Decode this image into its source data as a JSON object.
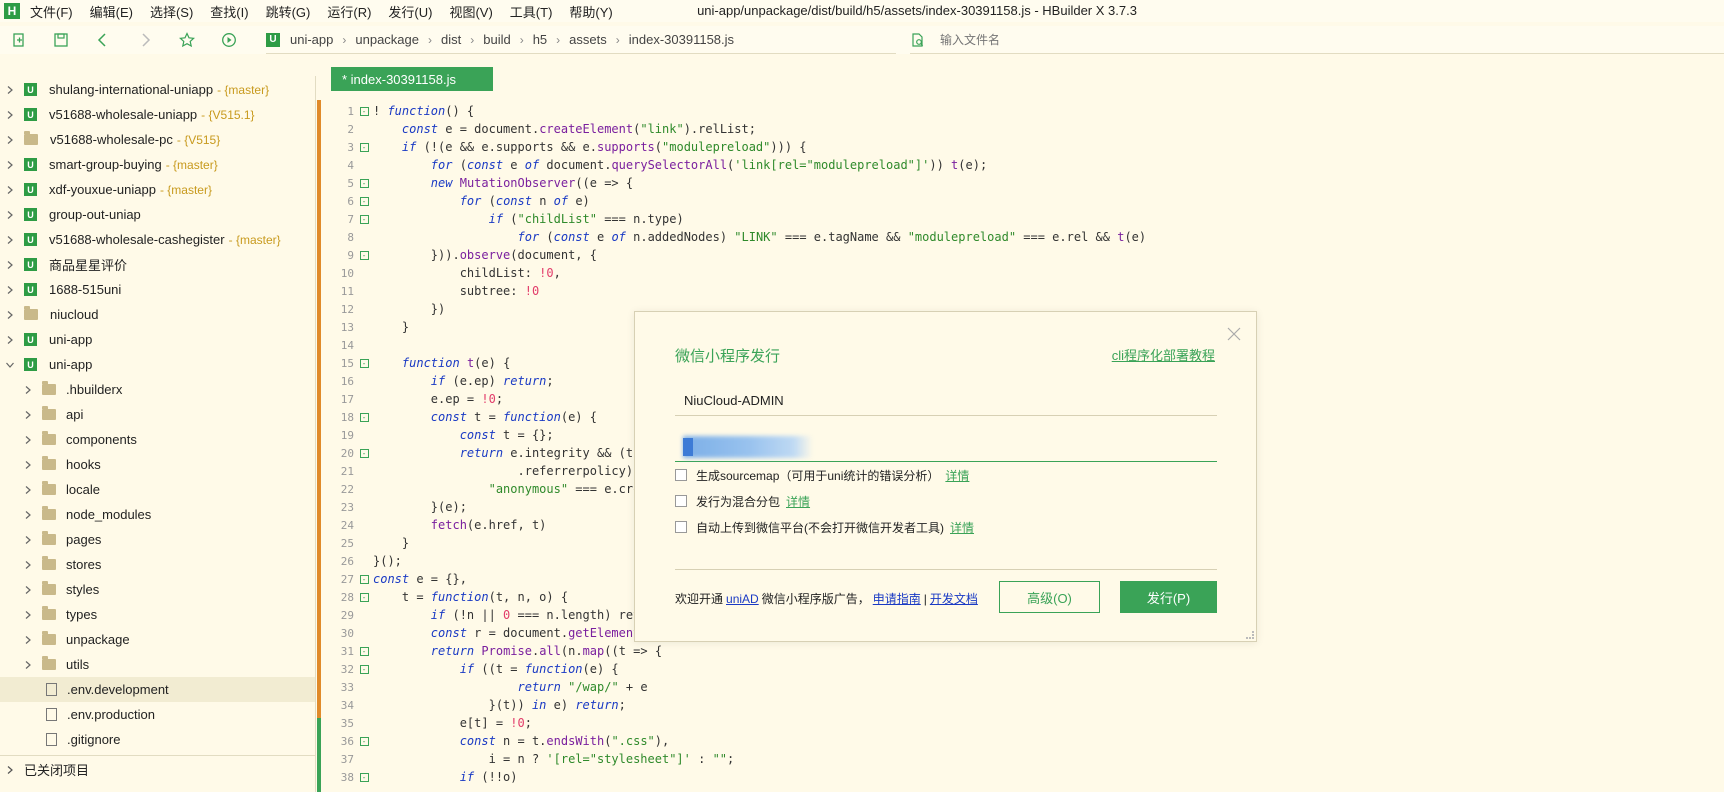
{
  "app": {
    "logo": "H",
    "window_title": "uni-app/unpackage/dist/build/h5/assets/index-30391158.js - HBuilder X 3.7.3"
  },
  "menu": [
    "文件(F)",
    "编辑(E)",
    "选择(S)",
    "查找(I)",
    "跳转(G)",
    "运行(R)",
    "发行(U)",
    "视图(V)",
    "工具(T)",
    "帮助(Y)"
  ],
  "toolbar": {
    "icons": [
      "new-file-icon",
      "save-icon",
      "back-icon",
      "forward-icon",
      "star-icon",
      "run-icon"
    ],
    "breadcrumb_logo": "U",
    "breadcrumb": [
      "uni-app",
      "unpackage",
      "dist",
      "build",
      "h5",
      "assets",
      "index-30391158.js"
    ],
    "file_search_placeholder": "输入文件名"
  },
  "sidebar": {
    "items": [
      {
        "label": "shulang-international-uniapp",
        "branch": "- {master}",
        "type": "project",
        "chevron": "right"
      },
      {
        "label": "v51688-wholesale-uniapp",
        "branch": "- {V515.1}",
        "type": "project",
        "chevron": "right"
      },
      {
        "label": "v51688-wholesale-pc",
        "branch": "- {V515}",
        "type": "folder-project",
        "chevron": "right"
      },
      {
        "label": "smart-group-buying",
        "branch": "- {master}",
        "type": "project",
        "chevron": "right"
      },
      {
        "label": "xdf-youxue-uniapp",
        "branch": "- {master}",
        "type": "project",
        "chevron": "right"
      },
      {
        "label": "group-out-uniap",
        "branch": "",
        "type": "project",
        "chevron": "right"
      },
      {
        "label": "v51688-wholesale-cashegister",
        "branch": "- {master}",
        "type": "project",
        "chevron": "right"
      },
      {
        "label": "商品星星评价",
        "branch": "",
        "type": "project",
        "chevron": "right"
      },
      {
        "label": "1688-515uni",
        "branch": "",
        "type": "project",
        "chevron": "right"
      },
      {
        "label": "niucloud",
        "branch": "",
        "type": "folder-project",
        "chevron": "right"
      },
      {
        "label": "uni-app",
        "branch": "",
        "type": "project",
        "chevron": "right"
      },
      {
        "label": "uni-app",
        "branch": "",
        "type": "project",
        "chevron": "down"
      },
      {
        "label": ".hbuilderx",
        "branch": "",
        "type": "folder",
        "chevron": "right"
      },
      {
        "label": "api",
        "branch": "",
        "type": "folder",
        "chevron": "right"
      },
      {
        "label": "components",
        "branch": "",
        "type": "folder",
        "chevron": "right"
      },
      {
        "label": "hooks",
        "branch": "",
        "type": "folder",
        "chevron": "right"
      },
      {
        "label": "locale",
        "branch": "",
        "type": "folder",
        "chevron": "right"
      },
      {
        "label": "node_modules",
        "branch": "",
        "type": "folder",
        "chevron": "right"
      },
      {
        "label": "pages",
        "branch": "",
        "type": "folder",
        "chevron": "right"
      },
      {
        "label": "stores",
        "branch": "",
        "type": "folder",
        "chevron": "right"
      },
      {
        "label": "styles",
        "branch": "",
        "type": "folder",
        "chevron": "right"
      },
      {
        "label": "types",
        "branch": "",
        "type": "folder",
        "chevron": "right"
      },
      {
        "label": "unpackage",
        "branch": "",
        "type": "folder",
        "chevron": "right"
      },
      {
        "label": "utils",
        "branch": "",
        "type": "folder",
        "chevron": "right"
      },
      {
        "label": ".env.development",
        "branch": "",
        "type": "file",
        "chevron": "none",
        "selected": true
      },
      {
        "label": ".env.production",
        "branch": "",
        "type": "file",
        "chevron": "none"
      },
      {
        "label": ".gitignore",
        "branch": "",
        "type": "file",
        "chevron": "none"
      }
    ],
    "footer_label": "已关闭项目"
  },
  "editor": {
    "tab_label": "* index-30391158.js",
    "lines": [
      {
        "n": "1",
        "fold": "-",
        "html": "! <span class='kw'>function</span>() {"
      },
      {
        "n": "2",
        "fold": "",
        "html": "    <span class='kw'>const</span> e = document.<span class='fn'>createElement</span>(<span class='str'>\"link\"</span>).relList;"
      },
      {
        "n": "3",
        "fold": "-",
        "html": "    <span class='kw'>if</span> (!(e &amp;&amp; e.supports &amp;&amp; e.<span class='fn'>supports</span>(<span class='str'>\"modulepreload\"</span>))) {"
      },
      {
        "n": "4",
        "fold": "",
        "html": "        <span class='kw'>for</span> (<span class='kw'>const</span> e <span class='kw'>of</span> document.<span class='fn'>querySelectorAll</span>(<span class='str'>'link[rel=\"modulepreload\"]'</span>)) <span class='fn'>t</span>(e);"
      },
      {
        "n": "5",
        "fold": "-",
        "html": "        <span class='kw'>new</span> <span class='fn'>MutationObserver</span>((e =&gt; {"
      },
      {
        "n": "6",
        "fold": "-",
        "html": "            <span class='kw'>for</span> (<span class='kw'>const</span> n <span class='kw'>of</span> e)"
      },
      {
        "n": "7",
        "fold": "-",
        "html": "                <span class='kw'>if</span> (<span class='str'>\"childList\"</span> === n.type)"
      },
      {
        "n": "8",
        "fold": "",
        "html": "                    <span class='kw'>for</span> (<span class='kw'>const</span> e <span class='kw'>of</span> n.addedNodes) <span class='str'>\"LINK\"</span> === e.tagName &amp;&amp; <span class='str'>\"modulepreload\"</span> === e.rel &amp;&amp; <span class='fn'>t</span>(e)"
      },
      {
        "n": "9",
        "fold": "-",
        "html": "        })).<span class='fn'>observe</span>(document, {"
      },
      {
        "n": "10",
        "fold": "",
        "html": "            childList: <span class='num'>!0</span>,"
      },
      {
        "n": "11",
        "fold": "",
        "html": "            subtree: <span class='num'>!0</span>"
      },
      {
        "n": "12",
        "fold": "",
        "html": "        })"
      },
      {
        "n": "13",
        "fold": "",
        "html": "    }"
      },
      {
        "n": "14",
        "fold": "",
        "html": ""
      },
      {
        "n": "15",
        "fold": "-",
        "html": "    <span class='kw'>function</span> <span class='fn'>t</span>(e) {"
      },
      {
        "n": "16",
        "fold": "",
        "html": "        <span class='kw'>if</span> (e.ep) <span class='kw'>return</span>;"
      },
      {
        "n": "17",
        "fold": "",
        "html": "        e.ep = <span class='num'>!0</span>;"
      },
      {
        "n": "18",
        "fold": "-",
        "html": "        <span class='kw'>const</span> t = <span class='kw'>function</span>(e) {"
      },
      {
        "n": "19",
        "fold": "",
        "html": "            <span class='kw'>const</span> t = {};"
      },
      {
        "n": "20",
        "fold": "-",
        "html": "            <span class='kw'>return</span> e.integrity &amp;&amp; (t."
      },
      {
        "n": "21",
        "fold": "",
        "html": "                    .referrerpolicy),"
      },
      {
        "n": "22",
        "fold": "",
        "html": "                <span class='str'>\"anonymous\"</span> === e.cro"
      },
      {
        "n": "23",
        "fold": "",
        "html": "        }(e);"
      },
      {
        "n": "24",
        "fold": "",
        "html": "        <span class='fn'>fetch</span>(e.href, t)"
      },
      {
        "n": "25",
        "fold": "",
        "html": "    }"
      },
      {
        "n": "26",
        "fold": "",
        "html": "}();"
      },
      {
        "n": "27",
        "fold": "-",
        "html": "<span class='kw'>const</span> e = {},"
      },
      {
        "n": "28",
        "fold": "-",
        "html": "    t = <span class='kw'>function</span>(t, n, o) {"
      },
      {
        "n": "29",
        "fold": "",
        "html": "        <span class='kw'>if</span> (!n || <span class='num'>0</span> === n.length) ret"
      },
      {
        "n": "30",
        "fold": "",
        "html": "        <span class='kw'>const</span> r = document.<span class='fn'>getElement</span>"
      },
      {
        "n": "31",
        "fold": "-",
        "html": "        <span class='kw'>return</span> <span class='fn'>Promise</span>.<span class='fn'>all</span>(n.<span class='fn'>map</span>((t =&gt; {"
      },
      {
        "n": "32",
        "fold": "-",
        "html": "            <span class='kw'>if</span> ((t = <span class='kw'>function</span>(e) {"
      },
      {
        "n": "33",
        "fold": "",
        "html": "                    <span class='kw'>return</span> <span class='str'>\"/wap/\"</span> + e"
      },
      {
        "n": "34",
        "fold": "",
        "html": "                }(t)) <span class='kw'>in</span> e) <span class='kw'>return</span>;"
      },
      {
        "n": "35",
        "fold": "",
        "html": "            e[t] = <span class='num'>!0</span>;"
      },
      {
        "n": "36",
        "fold": "-",
        "html": "            <span class='kw'>const</span> n = t.<span class='fn'>endsWith</span>(<span class='str'>\".css\"</span>),"
      },
      {
        "n": "37",
        "fold": "",
        "html": "                i = n ? <span class='str'>'[rel=\"stylesheet\"]'</span> : <span class='str'>\"\"</span>;"
      },
      {
        "n": "38",
        "fold": "-",
        "html": "            <span class='kw'>if</span> (!!o)"
      }
    ]
  },
  "dialog": {
    "title": "微信小程序发行",
    "cli_link": "cli程序化部署教程",
    "app_name_value": "NiuCloud-ADMIN",
    "checkboxes": [
      {
        "label": "生成sourcemap（可用于uni统计的错误分析）",
        "link": "详情",
        "checked": false
      },
      {
        "label": "发行为混合分包",
        "link": "详情",
        "checked": false
      },
      {
        "label": "自动上传到微信平台(不会打开微信开发者工具)",
        "link": "详情",
        "checked": false
      }
    ],
    "footer": {
      "prefix": "欢迎开通",
      "uniad": "uniAD",
      "middle": "微信小程序版广告，",
      "guide": "申请指南",
      "sep": "|",
      "docs": "开发文档"
    },
    "advanced_button": "高级(O)",
    "publish_button": "发行(P)"
  },
  "colors": {
    "accent_green": "#3aa357",
    "background": "#fffae8",
    "branch": "#c89a1e",
    "modified_bar": "#e08a2a"
  }
}
